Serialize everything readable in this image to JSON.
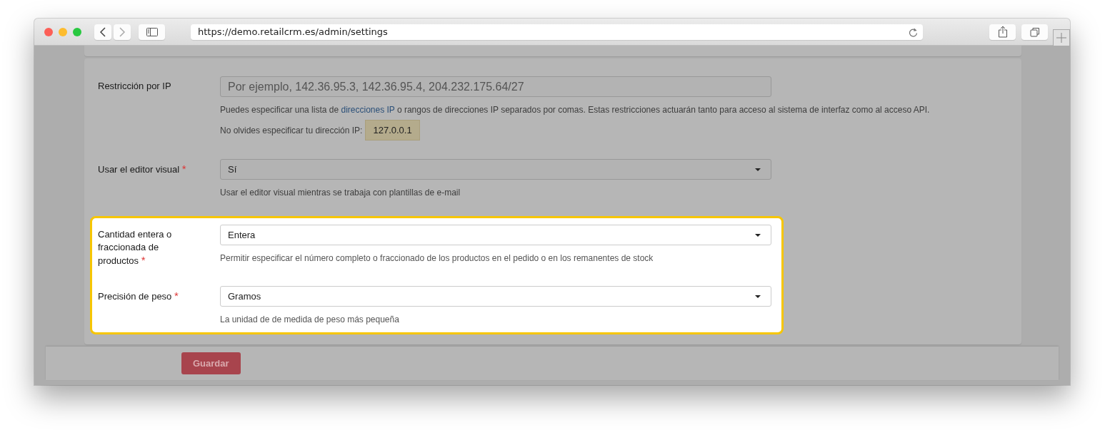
{
  "browser": {
    "url": "https://demo.retailcrm.es/admin/settings"
  },
  "sections": [
    {
      "highlighted": false,
      "fields": [
        {
          "kind": "text",
          "label": "Restricción por IP",
          "placeholder": "Por ejemplo, 142.36.95.3, 142.36.95.4, 204.232.175.64/27",
          "help": {
            "before": "Puedes especificar una lista de",
            "link": "direcciones IP",
            "after": "o rangos de direcciones IP separados por comas. Estas restricciones actuarán tanto para acceso al sistema de interfaz como al acceso API."
          },
          "note": {
            "label": "No olvides especificar tu dirección IP:",
            "value": "127.0.0.1"
          }
        },
        {
          "kind": "select",
          "label": "Usar el editor visual",
          "required_mark": "*",
          "value": "Sí",
          "help": {
            "before": "Usar el editor visual mientras se trabaja con plantillas de e-mail"
          }
        }
      ]
    },
    {
      "highlighted": true,
      "fields": [
        {
          "kind": "select",
          "label": "Cantidad entera o fraccionada de productos",
          "required_mark": "*",
          "value": "Entera",
          "help": {
            "before": "Permitir especificar el número completo o fraccionado de los productos en el pedido o en los remanentes de stock"
          }
        },
        {
          "kind": "select",
          "label": "Precisión de peso",
          "required_mark": "*",
          "value": "Gramos",
          "help": {
            "before": "La unidad de de medida de peso más pequeña"
          }
        }
      ]
    }
  ],
  "footer": {
    "button": "Guardar"
  }
}
